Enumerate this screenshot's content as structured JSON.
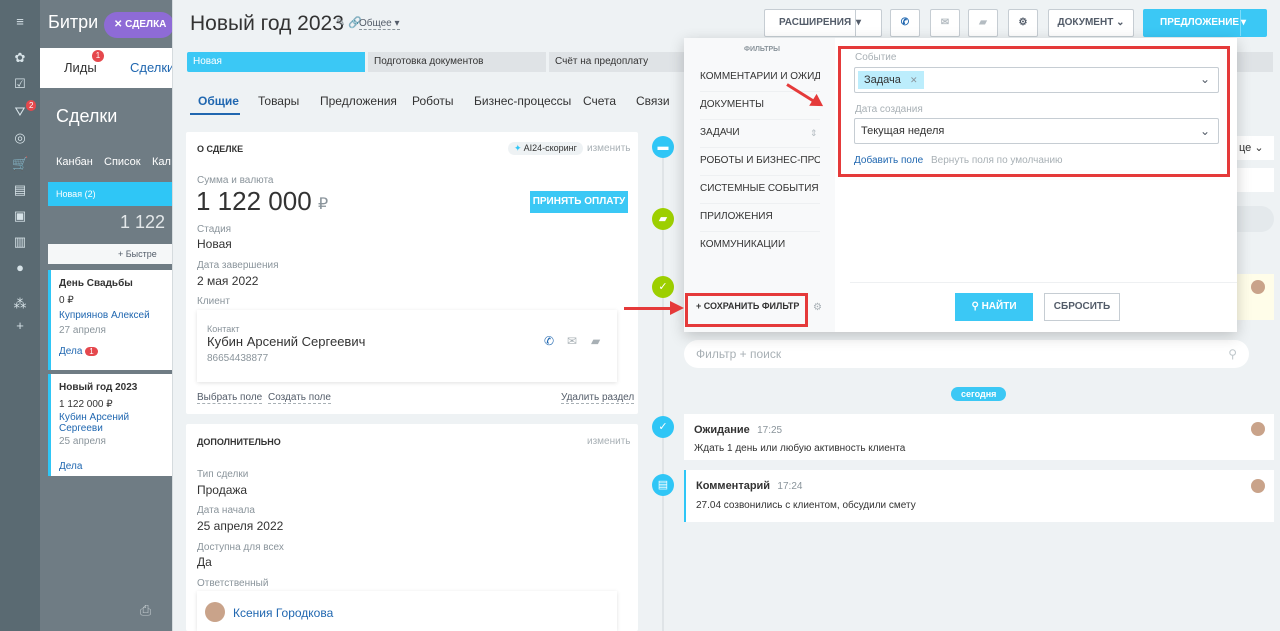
{
  "bg": {
    "app_title": "Битри",
    "deal_chip": "СДЕЛКА",
    "tabs": {
      "leads": "Лиды",
      "deals": "Сделки"
    },
    "leads_badge": "1",
    "page_title": "Сделки",
    "views": [
      "Канбан",
      "Список",
      "Кал"
    ],
    "column": {
      "name": "Новая",
      "count": "(2)",
      "sum": "1 122",
      "quick": "+ Быстре"
    },
    "cards": [
      {
        "title": "День Свадьбы",
        "sum": "0 ₽",
        "client": "Куприянов Алексей",
        "date": "27 апреля",
        "tasks": "Дела",
        "badge": "1"
      },
      {
        "title": "Новый год 2023",
        "sum": "1 122 000 ₽",
        "client": "Кубин Арсений Сергееви",
        "date": "25 апреля",
        "tasks": "Дела"
      }
    ]
  },
  "header": {
    "title": "Новый год 2023",
    "category": "Общее",
    "extensions_btn": "РАСШИРЕНИЯ",
    "document_btn": "ДОКУМЕНТ",
    "offer_btn": "ПРЕДЛОЖЕНИЕ"
  },
  "stages": [
    "Новая",
    "Подготовка документов",
    "Счёт на предоплату"
  ],
  "tabs": [
    "Общие",
    "Товары",
    "Предложения",
    "Роботы",
    "Бизнес-процессы",
    "Счета",
    "Связи"
  ],
  "about": {
    "heading": "О СДЕЛКЕ",
    "scoring": "AI24-скоринг",
    "edit": "изменить",
    "amount_label": "Сумма и валюта",
    "amount": "1 122 000",
    "currency": "₽",
    "pay_btn": "ПРИНЯТЬ ОПЛАТУ",
    "stage_label": "Стадия",
    "stage": "Новая",
    "close_label": "Дата завершения",
    "close_date": "2 мая 2022",
    "client_label": "Клиент",
    "contact_label": "Контакт",
    "contact_name": "Кубин Арсений Сергеевич",
    "contact_phone": "86654438877",
    "select_field": "Выбрать поле",
    "create_field": "Создать поле",
    "delete_section": "Удалить раздел"
  },
  "extra": {
    "heading": "ДОПОЛНИТЕЛЬНО",
    "edit": "изменить",
    "type_label": "Тип сделки",
    "type": "Продажа",
    "start_label": "Дата начала",
    "start_date": "25 апреля 2022",
    "public_label": "Доступна для всех",
    "public": "Да",
    "resp_label": "Ответственный",
    "resp_name": "Ксения Городкова"
  },
  "filter_popup": {
    "heading": "ФИЛЬТРЫ",
    "items": [
      "КОММЕНТАРИИ И ОЖИДА...",
      "ДОКУМЕНТЫ",
      "ЗАДАЧИ",
      "РОБОТЫ И БИЗНЕС-ПРОЦЕ...",
      "СИСТЕМНЫЕ СОБЫТИЯ",
      "ПРИЛОЖЕНИЯ",
      "КОММУНИКАЦИИ"
    ],
    "save_filter": "СОХРАНИТЬ ФИЛЬТР",
    "event_label": "Событие",
    "event_value": "Задача",
    "date_label": "Дата создания",
    "date_value": "Текущая неделя",
    "add_field": "Добавить поле",
    "reset_fields": "Вернуть поля по умолчанию",
    "find_btn": "НАЙТИ",
    "reset_btn": "СБРОСИТЬ"
  },
  "timeline": {
    "search_placeholder": "Фильтр + поиск",
    "today": "сегодня",
    "items": [
      {
        "title": "Ожидание",
        "time": "17:25",
        "text": "Ждать 1 день или любую активность клиента"
      },
      {
        "title": "Комментарий",
        "time": "17:24",
        "text": "27.04 созвонились с клиентом, обсудили смету"
      }
    ]
  }
}
